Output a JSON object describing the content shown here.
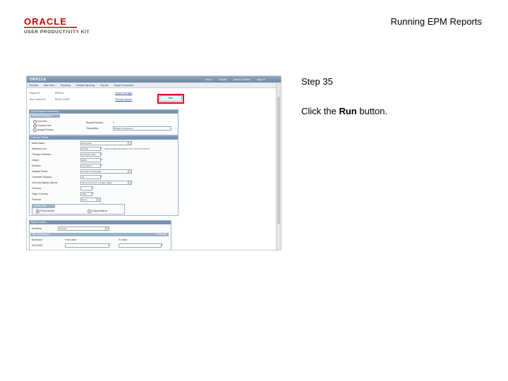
{
  "header": {
    "logo_brand": "ORACLE",
    "logo_product": "USER PRODUCTIVITY KIT",
    "title": "Running EPM Reports"
  },
  "step": {
    "label": "Step 35",
    "instruction_prefix": "Click the ",
    "instruction_target": "Run",
    "instruction_suffix": " button."
  },
  "colors": {
    "highlight": "#e2001a",
    "brand": "#cc0000"
  },
  "screenshot": {
    "brand": "ORACLE",
    "top_links": [
      "Home",
      "Worklist",
      "Add to Favorites",
      "Sign out"
    ],
    "menu": [
      "Favorites",
      "Main Menu",
      "Reporting",
      "Analysis Reporting",
      "Reports",
      "Budget Comparison"
    ],
    "report_id_label": "Report ID:",
    "report_id_value": "EPM101",
    "run_control_label": "Run Control ID:",
    "run_control_value": "BUDG COMP",
    "report_manager_link": "Report Manager",
    "process_monitor_link": "Process Monitor",
    "run_button": "Run",
    "section_report_request": "Report Request Parameters",
    "process_frequency": "Process Frequency",
    "freq_options": [
      "Don't Run",
      "Process Once",
      "Always Process"
    ],
    "request_number_label": "Request Number:",
    "request_number_value": "1",
    "description_label": "*Description:",
    "description_value": "Budget Comparison",
    "section_selection": "Selection Criteria",
    "fields": [
      {
        "label": "Model Name:",
        "value": "Enterprise"
      },
      {
        "label": "*Business Unit:",
        "value": "US001",
        "desc": "EMEA MODEL BUSINESS UNIT FOR REPORTING"
      },
      {
        "label": "*Scenario Selection:",
        "value": "ACTUAL ONLY"
      },
      {
        "label": "Ledger:",
        "value": "EPM"
      },
      {
        "label": "Scenario:",
        "value": "ACTUALS"
      },
      {
        "label": "Analysis Period:",
        "value": "Current Year Actuals"
      },
      {
        "label": "*Calendar Category:",
        "value": "01"
      },
      {
        "label": "Currency Display Options:",
        "value": "All Currencies to a Single Target"
      },
      {
        "label": "Currency:",
        "value": ""
      },
      {
        "label": "Target Currency:",
        "value": "USD"
      },
      {
        "label": "Precision:",
        "value": "None"
      }
    ],
    "activity_type": "Activity Type",
    "activity_options": [
      "Period Activity",
      "Ending Balance"
    ],
    "section_report_options": "Report Options",
    "hierarchy_label": "Hierarchy:",
    "hierarchy_value": "Account",
    "section_filter": "Filter Dimensions",
    "filter_customize": "Customize",
    "filter_columns": [
      "Dimension",
      "From Value",
      "To Value"
    ],
    "filter_row_dimension": "ACCOUNT"
  }
}
